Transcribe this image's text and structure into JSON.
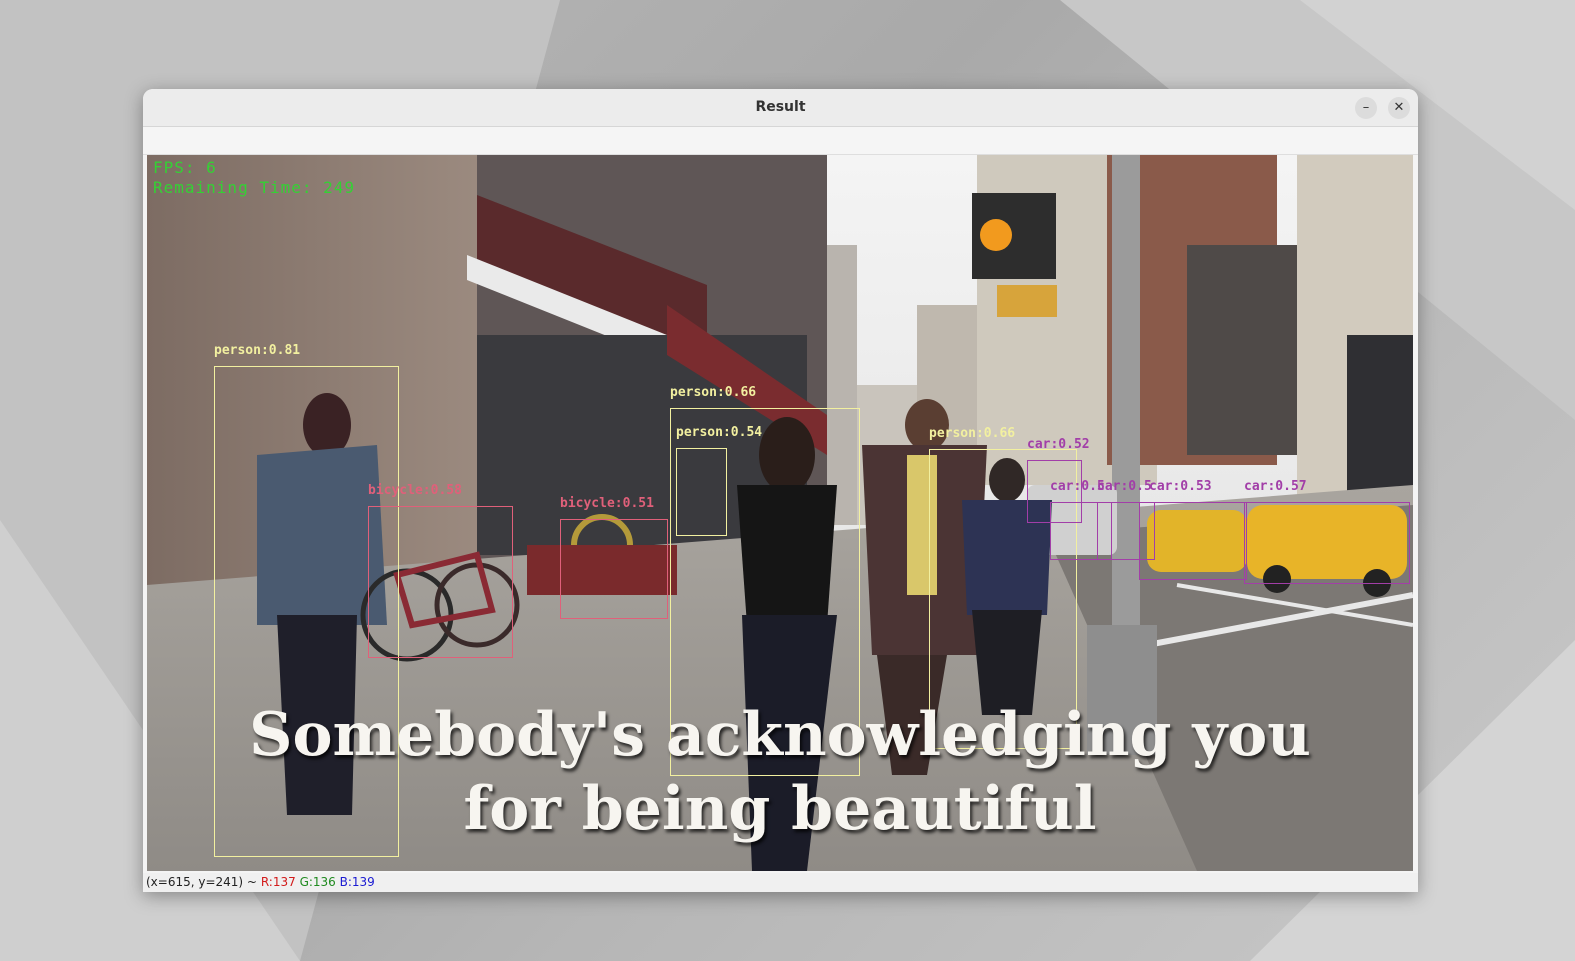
{
  "window": {
    "title": "Result",
    "minimize_label": "–",
    "close_label": "✕"
  },
  "hud": {
    "fps": "FPS: 6",
    "remaining": "Remaining Time: 249"
  },
  "detections": [
    {
      "label": "person:0.81",
      "kind": "person"
    },
    {
      "label": "person:0.66",
      "kind": "person"
    },
    {
      "label": "person:0.54",
      "kind": "person"
    },
    {
      "label": "person:0.66",
      "kind": "person"
    },
    {
      "label": "bicycle:0.58",
      "kind": "bicycle"
    },
    {
      "label": "bicycle:0.51",
      "kind": "bicycle"
    },
    {
      "label": "car:0.52",
      "kind": "car"
    },
    {
      "label": "car:0.5",
      "kind": "car"
    },
    {
      "label": "car:0.5",
      "kind": "car"
    },
    {
      "label": "car:0.53",
      "kind": "car"
    },
    {
      "label": "car:0.57",
      "kind": "car"
    }
  ],
  "subtitle": {
    "line1": "Somebody's acknowledging you",
    "line2": "for being beautiful"
  },
  "status": {
    "coords": "(x=615, y=241) ~",
    "r": "R:137",
    "g": "G:136",
    "b": "B:139"
  },
  "colors": {
    "person": "#f2f0a0",
    "bicycle": "#e0607a",
    "car": "#a23ea8",
    "hud": "#34d134",
    "status_r": "#d21b1b",
    "status_g": "#1f8a1f",
    "status_b": "#1b1bd2"
  }
}
